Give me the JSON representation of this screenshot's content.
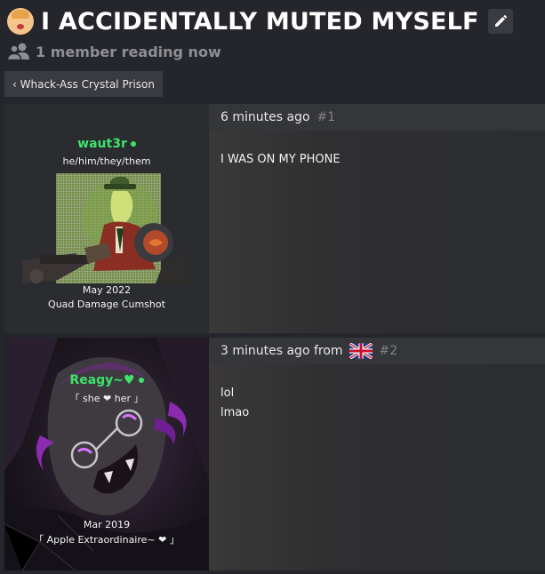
{
  "thread": {
    "title": "I ACCIDENTALLY MUTED MYSELF",
    "reading_now": "1 member reading now",
    "breadcrumb": "‹ Whack-Ass Crystal Prison"
  },
  "posts": [
    {
      "user": {
        "name": "waut3r",
        "pronouns": "he/him/they/them",
        "joined": "May 2022",
        "title": "Quad Damage Cumshot",
        "online": true
      },
      "meta": {
        "time": "6 minutes ago",
        "from": "",
        "number": "#1"
      },
      "body": [
        "I WAS ON MY PHONE"
      ]
    },
    {
      "user": {
        "name": "Reagy~♥",
        "pronouns": "「 she ❤ her 」",
        "joined": "Mar 2019",
        "title": "「 Apple Extraordinaire~ ❤ 」",
        "online": true
      },
      "meta": {
        "time": "3 minutes ago from",
        "from_flag": "gb-flag-icon",
        "number": "#2"
      },
      "body": [
        "lol",
        "lmao"
      ]
    }
  ],
  "colors": {
    "background": "#25262b",
    "username": "#3de36b",
    "muted": "#808186"
  }
}
